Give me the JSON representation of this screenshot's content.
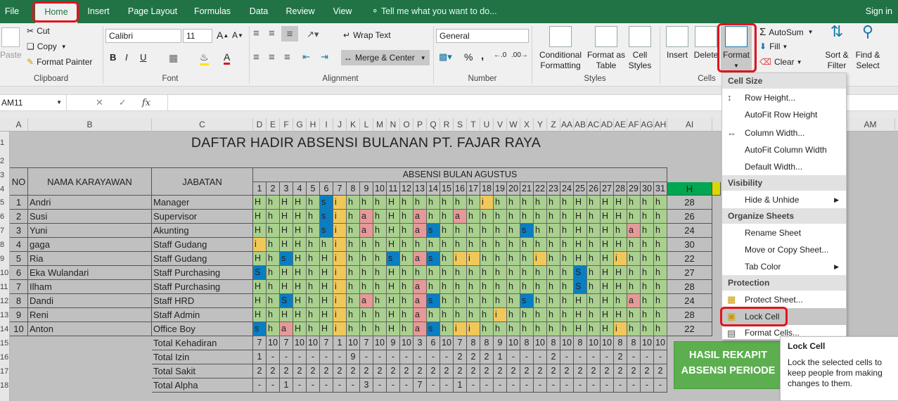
{
  "tabs": [
    "File",
    "Home",
    "Insert",
    "Page Layout",
    "Formulas",
    "Data",
    "Review",
    "View"
  ],
  "tell_me": "Tell me what you want to do...",
  "sign_in": "Sign in",
  "clipboard": {
    "paste": "Paste",
    "cut": "Cut",
    "copy": "Copy",
    "painter": "Format Painter",
    "label": "Clipboard"
  },
  "font": {
    "name": "Calibri",
    "size": "11",
    "label": "Font",
    "bold": "B",
    "italic": "I",
    "underline": "U"
  },
  "alignment": {
    "wrap": "Wrap Text",
    "merge": "Merge & Center",
    "label": "Alignment"
  },
  "number": {
    "format": "General",
    "percent": "%",
    "comma": ",",
    "label": "Number"
  },
  "styles": {
    "cond1": "Conditional",
    "cond2": "Formatting",
    "table1": "Format as",
    "table2": "Table",
    "cell1": "Cell",
    "cell2": "Styles",
    "label": "Styles"
  },
  "cells": {
    "insert": "Insert",
    "delete": "Delete",
    "format": "Format",
    "label": "Cells"
  },
  "editing": {
    "autosum": "AutoSum",
    "fill": "Fill",
    "clear": "Clear",
    "sort1": "Sort &",
    "sort2": "Filter",
    "find1": "Find &",
    "find2": "Select"
  },
  "namebox": "AM11",
  "fx": "fx",
  "columns": [
    "A",
    "B",
    "C",
    "D",
    "E",
    "F",
    "G",
    "H",
    "I",
    "J",
    "K",
    "L",
    "M",
    "N",
    "O",
    "P",
    "Q",
    "R",
    "S",
    "T",
    "U",
    "V",
    "W",
    "X",
    "Y",
    "Z",
    "AA",
    "AB",
    "AC",
    "AD",
    "AE",
    "AF",
    "AG",
    "AH",
    "AI",
    "AM"
  ],
  "rows": [
    "1",
    "2",
    "3",
    "4",
    "5",
    "6",
    "7",
    "8",
    "9",
    "10",
    "11",
    "12",
    "13",
    "14",
    "15",
    "16",
    "17",
    "18"
  ],
  "sheet": {
    "title": "DAFTAR HADIR ABSENSI BULANAN PT. FAJAR RAYA",
    "h_no": "NO",
    "h_nama": "NAMA KARAYAWAN",
    "h_jabatan": "JABATAN",
    "h_absensi": "ABSENSI BULAN AGUSTUS",
    "h_h": "H",
    "days": [
      "1",
      "2",
      "3",
      "4",
      "5",
      "6",
      "7",
      "8",
      "9",
      "10",
      "11",
      "12",
      "13",
      "14",
      "15",
      "16",
      "17",
      "18",
      "19",
      "20",
      "21",
      "22",
      "23",
      "24",
      "25",
      "26",
      "27",
      "28",
      "29",
      "30",
      "31"
    ],
    "employees": [
      {
        "no": "1",
        "name": "Andri",
        "job": "Manager",
        "att": "HhHHhsihhhHhhhhhhihhhhhhHhHHhhh",
        "total": "28"
      },
      {
        "no": "2",
        "name": "Susi",
        "job": "Supervisor",
        "att": "HhHHhsihahHhahhahhhhhhhhHhHHhhh",
        "total": "26"
      },
      {
        "no": "3",
        "name": "Yuni",
        "job": "Akunting",
        "att": "HhHHhsihahHhashhhhhhshhhHhHhahh",
        "total": "24"
      },
      {
        "no": "4",
        "name": "gaga",
        "job": "Staff Gudang",
        "att": "ihHHhhihhhHhhhhhhhhhhhhhHhHHhhh",
        "total": "30"
      },
      {
        "no": "5",
        "name": "Ria",
        "job": "Staff Gudang",
        "att": "HhsHhHihhhshashiihhhhihhHhHihhh",
        "total": "22"
      },
      {
        "no": "6",
        "name": "Eka Wulandari",
        "job": "Staff Purchasing",
        "att": "ShHHhHihhhHhhhhhhhhhhhhhShHHhhh",
        "total": "27"
      },
      {
        "no": "7",
        "name": "Ilham",
        "job": "Staff Purchasing",
        "att": "HhHHhHihhhHhahhhhhhhhhhhShHHhhh",
        "total": "28"
      },
      {
        "no": "8",
        "name": "Dandi",
        "job": "Staff HRD",
        "att": "HhSHhHihahHhashhhhhhshhhHhHhahh",
        "total": "24"
      },
      {
        "no": "9",
        "name": "Reni",
        "job": "Staff Admin",
        "att": "HhHHhHihhhHhahhhhhihhhhhHhHHhhh",
        "total": "28"
      },
      {
        "no": "10",
        "name": "Anton",
        "job": "Office Boy",
        "att": "shaHhHihhhHhashiihhhhhhhHhHihhh",
        "total": "22"
      }
    ],
    "summary": [
      {
        "label": "Total Kehadiran",
        "vals": [
          "7",
          "10",
          "7",
          "10",
          "10",
          "7",
          "1",
          "10",
          "7",
          "10",
          "9",
          "10",
          "3",
          "6",
          "10",
          "7",
          "8",
          "8",
          "9",
          "10",
          "8",
          "10",
          "8",
          "10",
          "8",
          "10",
          "10",
          "8",
          "8",
          "10",
          "10"
        ]
      },
      {
        "label": "Total Izin",
        "vals": [
          "1",
          "-",
          "-",
          "-",
          "-",
          "-",
          "-",
          "9",
          "-",
          "-",
          "-",
          "-",
          "-",
          "-",
          "-",
          "2",
          "2",
          "2",
          "1",
          "-",
          "-",
          "-",
          "2",
          "-",
          "-",
          "-",
          "-",
          "2",
          "-",
          "-",
          "-"
        ]
      },
      {
        "label": "Total Sakit",
        "vals": [
          "2",
          "2",
          "2",
          "2",
          "2",
          "2",
          "2",
          "2",
          "2",
          "2",
          "2",
          "2",
          "2",
          "2",
          "2",
          "2",
          "2",
          "2",
          "2",
          "2",
          "2",
          "2",
          "2",
          "2",
          "2",
          "2",
          "2",
          "2",
          "2",
          "2",
          "2"
        ]
      },
      {
        "label": "Total Alpha",
        "vals": [
          "-",
          "-",
          "1",
          "-",
          "-",
          "-",
          "-",
          "-",
          "3",
          "-",
          "-",
          "-",
          "7",
          "-",
          "-",
          "1",
          "-",
          "-",
          "-",
          "-",
          "-",
          "-",
          "-",
          "-",
          "-",
          "-",
          "-",
          "-",
          "-",
          "-",
          "-"
        ]
      }
    ],
    "box1": "HASIL REKAPIT",
    "box2": "ABSENSI PERIODE"
  },
  "menu": {
    "cell_size": "Cell Size",
    "row_height": "Row Height...",
    "autofit_row": "AutoFit Row Height",
    "col_width": "Column Width...",
    "autofit_col": "AutoFit Column Width",
    "default_width": "Default Width...",
    "visibility": "Visibility",
    "hide": "Hide & Unhide",
    "organize": "Organize Sheets",
    "rename": "Rename Sheet",
    "move": "Move or Copy Sheet...",
    "tabcolor": "Tab Color",
    "protection": "Protection",
    "protect": "Protect Sheet...",
    "lock": "Lock Cell",
    "format_cells": "Format Cells..."
  },
  "tooltip": {
    "title": "Lock Cell",
    "desc": "Lock the selected cells to keep people from making changes to them."
  },
  "colors": {
    "green": "#a9d08e",
    "blue": "#0a7ec2",
    "yellow": "#f0c85a",
    "pink": "#e69999",
    "red": "#e0141e",
    "excel": "#217346"
  }
}
